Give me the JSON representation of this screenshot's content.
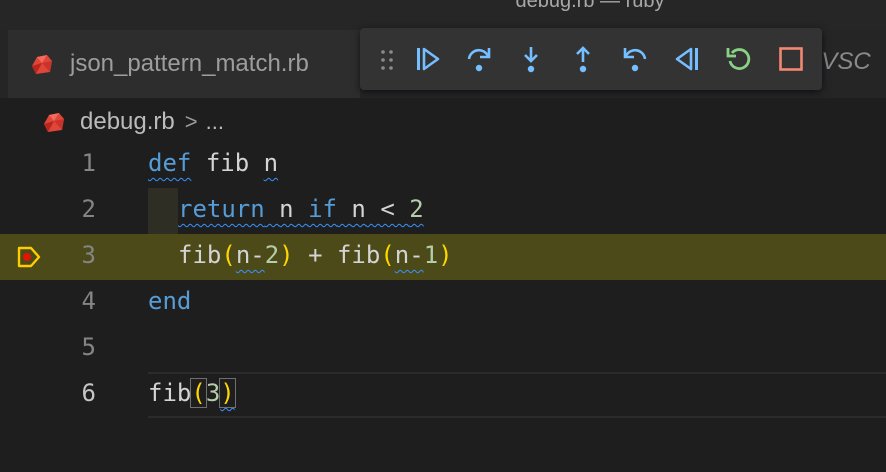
{
  "window": {
    "title": "debug.rb — ruby"
  },
  "tabs": [
    {
      "label": "json_pattern_match.rb",
      "icon": "ruby-icon"
    }
  ],
  "tab_overflow_text": ": VSC",
  "breadcrumb": {
    "file": "debug.rb",
    "separator": ">",
    "more": "..."
  },
  "debug_toolbar": {
    "buttons": [
      {
        "name": "continue",
        "icon": "continue-icon"
      },
      {
        "name": "step-over",
        "icon": "step-over-icon"
      },
      {
        "name": "step-into",
        "icon": "step-into-icon"
      },
      {
        "name": "step-out",
        "icon": "step-out-icon"
      },
      {
        "name": "step-back",
        "icon": "step-back-icon"
      },
      {
        "name": "reverse-continue",
        "icon": "reverse-continue-icon"
      },
      {
        "name": "restart",
        "icon": "restart-icon"
      },
      {
        "name": "stop",
        "icon": "stop-icon"
      }
    ]
  },
  "colors": {
    "accent_blue": "#75beff",
    "restart_green": "#89d185",
    "stop_red": "#f48771",
    "current_line_bg": "#4b4a18",
    "breakpoint_yellow": "#ffcc00",
    "breakpoint_red": "#e51400"
  },
  "editor": {
    "lines": [
      {
        "num": "1",
        "t": [
          "def",
          " ",
          "fib",
          " ",
          "n"
        ]
      },
      {
        "num": "2",
        "t": [
          "return",
          " ",
          "n",
          " ",
          "if",
          " ",
          "n",
          " < ",
          "2"
        ]
      },
      {
        "num": "3",
        "t": [
          "fib",
          "(",
          "n-",
          "2",
          ")",
          " + ",
          "fib",
          "(",
          "n-",
          "1",
          ")"
        ]
      },
      {
        "num": "4",
        "t": [
          "end"
        ]
      },
      {
        "num": "5",
        "t": []
      },
      {
        "num": "6",
        "t": [
          "fib",
          "(",
          "3",
          ")"
        ]
      }
    ],
    "current_line": "3",
    "active_cursor_line": "6"
  }
}
